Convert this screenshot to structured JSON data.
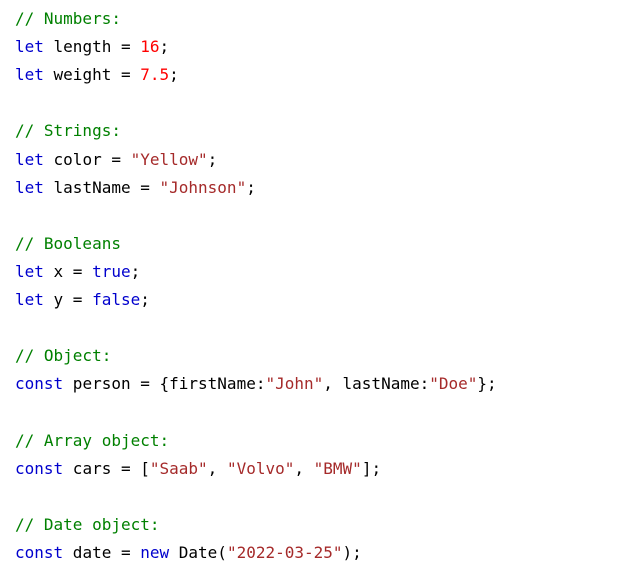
{
  "colors": {
    "comment": "#008000",
    "keyword": "#0000cd",
    "number": "#ff0000",
    "string": "#a52a2a",
    "plain": "#000000"
  },
  "lines": [
    [
      {
        "t": "// Numbers:",
        "c": "cm"
      }
    ],
    [
      {
        "t": "let",
        "c": "kw"
      },
      {
        "t": " length = ",
        "c": "pl"
      },
      {
        "t": "16",
        "c": "num"
      },
      {
        "t": ";",
        "c": "pl"
      }
    ],
    [
      {
        "t": "let",
        "c": "kw"
      },
      {
        "t": " weight = ",
        "c": "pl"
      },
      {
        "t": "7.5",
        "c": "num"
      },
      {
        "t": ";",
        "c": "pl"
      }
    ],
    [],
    [
      {
        "t": "// Strings:",
        "c": "cm"
      }
    ],
    [
      {
        "t": "let",
        "c": "kw"
      },
      {
        "t": " color = ",
        "c": "pl"
      },
      {
        "t": "\"Yellow\"",
        "c": "str"
      },
      {
        "t": ";",
        "c": "pl"
      }
    ],
    [
      {
        "t": "let",
        "c": "kw"
      },
      {
        "t": " lastName = ",
        "c": "pl"
      },
      {
        "t": "\"Johnson\"",
        "c": "str"
      },
      {
        "t": ";",
        "c": "pl"
      }
    ],
    [],
    [
      {
        "t": "// Booleans",
        "c": "cm"
      }
    ],
    [
      {
        "t": "let",
        "c": "kw"
      },
      {
        "t": " x = ",
        "c": "pl"
      },
      {
        "t": "true",
        "c": "kw"
      },
      {
        "t": ";",
        "c": "pl"
      }
    ],
    [
      {
        "t": "let",
        "c": "kw"
      },
      {
        "t": " y = ",
        "c": "pl"
      },
      {
        "t": "false",
        "c": "kw"
      },
      {
        "t": ";",
        "c": "pl"
      }
    ],
    [],
    [
      {
        "t": "// Object:",
        "c": "cm"
      }
    ],
    [
      {
        "t": "const",
        "c": "kw"
      },
      {
        "t": " person = {firstName:",
        "c": "pl"
      },
      {
        "t": "\"John\"",
        "c": "str"
      },
      {
        "t": ", lastName:",
        "c": "pl"
      },
      {
        "t": "\"Doe\"",
        "c": "str"
      },
      {
        "t": "};",
        "c": "pl"
      }
    ],
    [],
    [
      {
        "t": "// Array object:",
        "c": "cm"
      }
    ],
    [
      {
        "t": "const",
        "c": "kw"
      },
      {
        "t": " cars = [",
        "c": "pl"
      },
      {
        "t": "\"Saab\"",
        "c": "str"
      },
      {
        "t": ", ",
        "c": "pl"
      },
      {
        "t": "\"Volvo\"",
        "c": "str"
      },
      {
        "t": ", ",
        "c": "pl"
      },
      {
        "t": "\"BMW\"",
        "c": "str"
      },
      {
        "t": "];",
        "c": "pl"
      }
    ],
    [],
    [
      {
        "t": "// Date object:",
        "c": "cm"
      }
    ],
    [
      {
        "t": "const",
        "c": "kw"
      },
      {
        "t": " date = ",
        "c": "pl"
      },
      {
        "t": "new",
        "c": "kw"
      },
      {
        "t": " Date(",
        "c": "pl"
      },
      {
        "t": "\"2022-03-25\"",
        "c": "str"
      },
      {
        "t": ");",
        "c": "pl"
      }
    ]
  ]
}
